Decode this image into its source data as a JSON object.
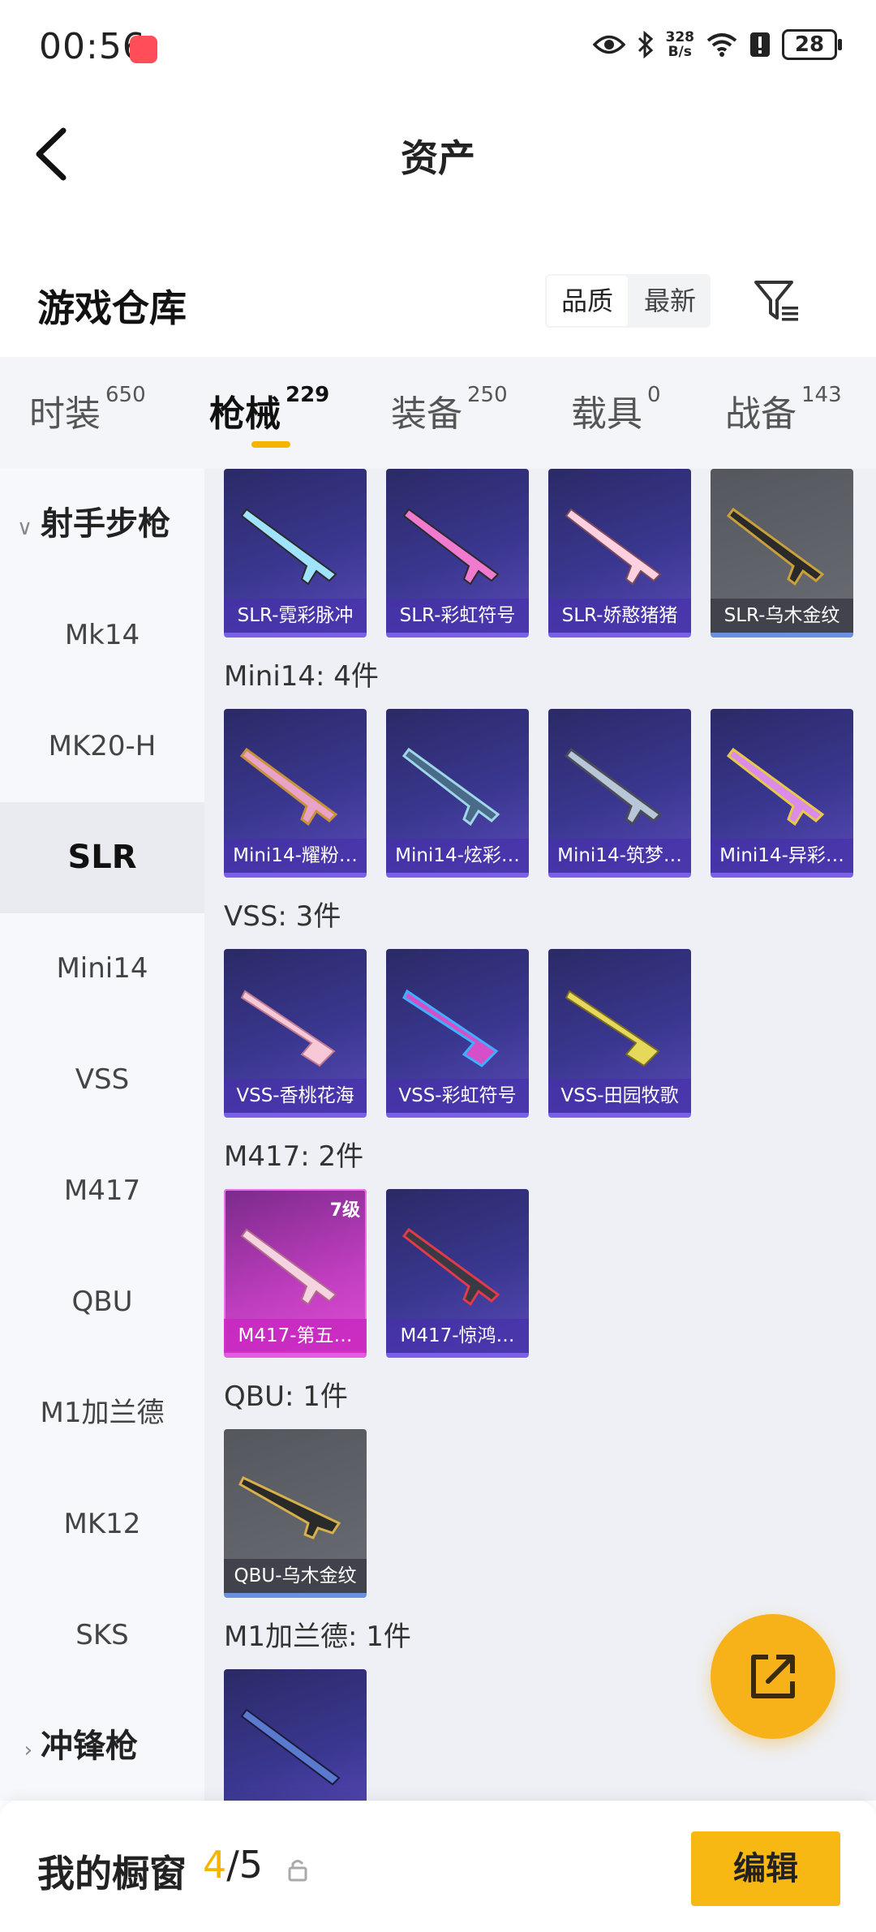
{
  "status_bar": {
    "time": "00:56",
    "net_speed_value": "328",
    "net_speed_unit": "B/s",
    "battery": "28"
  },
  "header": {
    "title": "资产"
  },
  "warehouse": {
    "title": "游戏仓库",
    "sort_options": [
      "品质",
      "最新"
    ],
    "sort_active": "品质"
  },
  "tabs": [
    {
      "label": "时装",
      "count": "650"
    },
    {
      "label": "枪械",
      "count": "229"
    },
    {
      "label": "装备",
      "count": "250"
    },
    {
      "label": "载具",
      "count": "0"
    },
    {
      "label": "战备",
      "count": "143"
    }
  ],
  "active_tab": "枪械",
  "sidebar": {
    "group": "射手步枪",
    "items": [
      "Mk14",
      "MK20-H",
      "SLR",
      "Mini14",
      "VSS",
      "M417",
      "QBU",
      "M1加兰德",
      "MK12",
      "SKS"
    ],
    "active": "SLR",
    "collapsed_group": "冲锋枪"
  },
  "sections": [
    {
      "label": "",
      "items": [
        {
          "name": "SLR-霓彩脉冲",
          "style": "purple"
        },
        {
          "name": "SLR-彩虹符号",
          "style": "purple"
        },
        {
          "name": "SLR-娇憨猪猪",
          "style": "purple"
        },
        {
          "name": "SLR-乌木金纹",
          "style": "gray"
        }
      ]
    },
    {
      "label": "Mini14: 4件",
      "items": [
        {
          "name": "Mini14-耀粉…",
          "style": "purple"
        },
        {
          "name": "Mini14-炫彩…",
          "style": "purple"
        },
        {
          "name": "Mini14-筑梦…",
          "style": "purple"
        },
        {
          "name": "Mini14-异彩…",
          "style": "purple"
        }
      ]
    },
    {
      "label": "VSS: 3件",
      "items": [
        {
          "name": "VSS-香桃花海",
          "style": "purple"
        },
        {
          "name": "VSS-彩虹符号",
          "style": "purple"
        },
        {
          "name": "VSS-田园牧歌",
          "style": "purple"
        }
      ]
    },
    {
      "label": "M417: 2件",
      "items": [
        {
          "name": "M417-第五…",
          "style": "pink",
          "level": "7级"
        },
        {
          "name": "M417-惊鸿…",
          "style": "purple"
        }
      ]
    },
    {
      "label": "QBU: 1件",
      "items": [
        {
          "name": "QBU-乌木金纹",
          "style": "gray"
        }
      ]
    },
    {
      "label": "M1加兰德: 1件",
      "items": [
        {
          "name": "",
          "style": "purple"
        }
      ]
    }
  ],
  "bottom_bar": {
    "title": "我的橱窗",
    "current": "4",
    "max": "5",
    "edit_label": "编辑"
  },
  "colors": {
    "accent": "#f5b400",
    "card_purple": "#3a3790",
    "card_gray": "#60626a",
    "card_pink": "#c13ec0"
  }
}
